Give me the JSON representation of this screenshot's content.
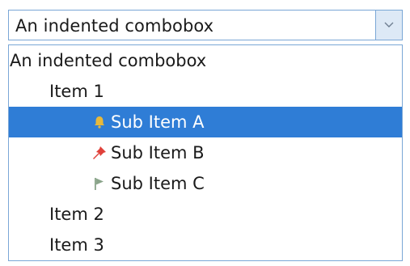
{
  "combobox": {
    "selected_text": "An indented combobox",
    "dropdown_icon": "chevron-down-icon"
  },
  "dropdown": {
    "items": [
      {
        "label": "An indented combobox",
        "level": 0,
        "icon": null,
        "selected": false
      },
      {
        "label": "Item 1",
        "level": 1,
        "icon": null,
        "selected": false
      },
      {
        "label": "Sub Item A",
        "level": 2,
        "icon": "bell-icon",
        "selected": true
      },
      {
        "label": "Sub Item B",
        "level": 2,
        "icon": "pushpin-icon",
        "selected": false
      },
      {
        "label": "Sub Item C",
        "level": 2,
        "icon": "flag-icon",
        "selected": false
      },
      {
        "label": "Item 2",
        "level": 1,
        "icon": null,
        "selected": false
      },
      {
        "label": "Item 3",
        "level": 1,
        "icon": null,
        "selected": false
      }
    ]
  },
  "colors": {
    "border": "#7aa7d6",
    "selection": "#2f7dd6",
    "bell": "#e8b93a",
    "pushpin": "#e0413a",
    "flag": "#8aa48a"
  }
}
